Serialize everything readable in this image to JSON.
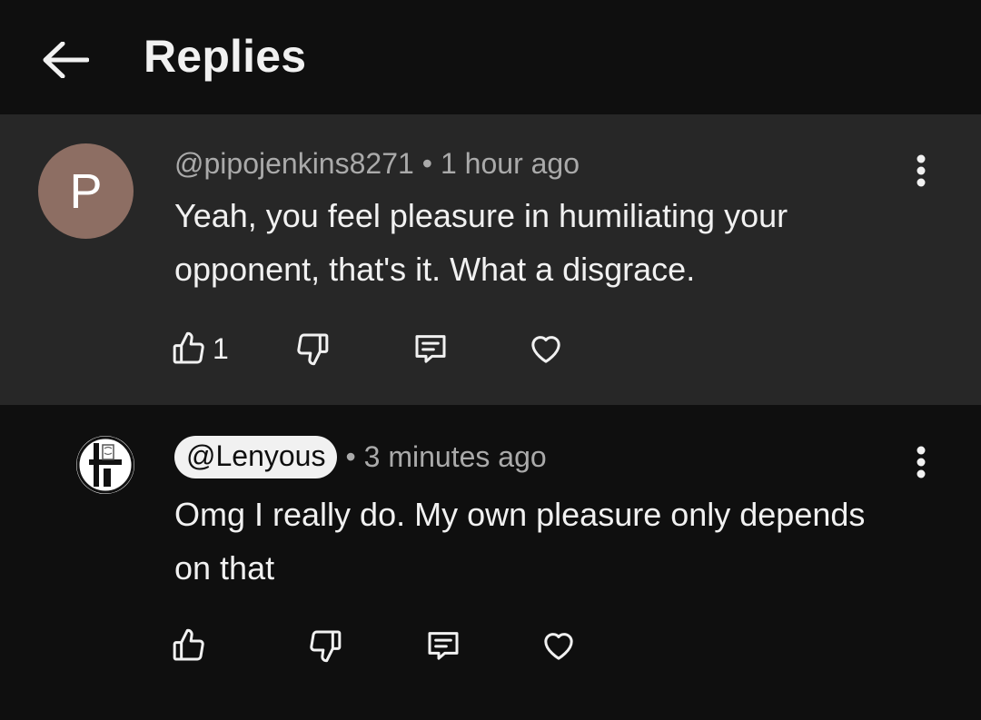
{
  "header": {
    "title": "Replies",
    "back_icon": "arrow-left-icon"
  },
  "colors": {
    "background": "#0f0f0f",
    "highlighted_comment_bg": "#272727",
    "avatar_p": "#8d6e63",
    "secondary_text": "#aaaaaa",
    "primary_text": "#f1f1f1"
  },
  "parent_comment": {
    "avatar_letter": "P",
    "author": "@pipojenkins8271",
    "separator": "•",
    "time": "1 hour ago",
    "text": "Yeah, you feel pleasure in humiliating your opponent, that's it. What a disgrace.",
    "like_count": "1",
    "actions": [
      "thumbs-up-icon",
      "thumbs-down-icon",
      "comment-icon",
      "heart-icon"
    ]
  },
  "reply_comment": {
    "author": "@Lenyous",
    "separator": "•",
    "time": "3 minutes ago",
    "text": "Omg I really do. My own pleasure only depends on that",
    "actions": [
      "thumbs-up-icon",
      "thumbs-down-icon",
      "comment-icon",
      "heart-icon"
    ]
  }
}
